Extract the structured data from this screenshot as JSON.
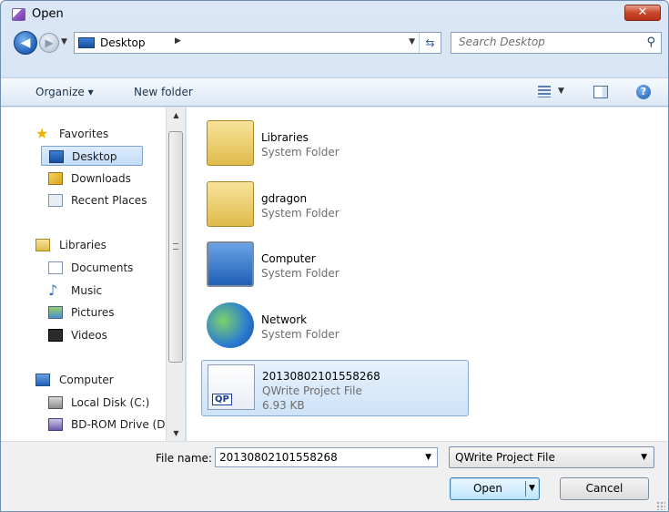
{
  "window": {
    "title": "Open"
  },
  "nav": {
    "back_glyph": "◀",
    "forward_glyph": "▶",
    "address": "Desktop",
    "search_placeholder": "Search Desktop"
  },
  "toolbar": {
    "organize": "Organize ▾",
    "new_folder": "New folder",
    "help": "?"
  },
  "sidebar": {
    "items": [
      {
        "label": "Favorites",
        "icon": "star-icon"
      },
      {
        "label": "Desktop",
        "icon": "desktop-icon",
        "selected": true
      },
      {
        "label": "Downloads",
        "icon": "downloads-icon"
      },
      {
        "label": "Recent Places",
        "icon": "recent-places-icon"
      },
      {
        "label": "Libraries",
        "icon": "libraries-icon"
      },
      {
        "label": "Documents",
        "icon": "documents-icon"
      },
      {
        "label": "Music",
        "icon": "music-icon"
      },
      {
        "label": "Pictures",
        "icon": "pictures-icon"
      },
      {
        "label": "Videos",
        "icon": "videos-icon"
      },
      {
        "label": "Computer",
        "icon": "computer-icon"
      },
      {
        "label": "Local Disk (C:)",
        "icon": "local-disk-icon"
      },
      {
        "label": "BD-ROM Drive (D",
        "icon": "bd-rom-icon"
      }
    ]
  },
  "files": [
    {
      "name": "Libraries",
      "type": "System Folder",
      "icon": "libraries-folder-icon"
    },
    {
      "name": "gdragon",
      "type": "System Folder",
      "icon": "user-folder-icon"
    },
    {
      "name": "Computer",
      "type": "System Folder",
      "icon": "computer-icon"
    },
    {
      "name": "Network",
      "type": "System Folder",
      "icon": "network-icon"
    },
    {
      "name": "20130802101558268",
      "type": "QWrite Project File",
      "size": "6.93 KB",
      "icon": "qwrite-file-icon",
      "badge": "QP",
      "selected": true
    }
  ],
  "footer": {
    "file_name_label": "File name:",
    "file_name_value": "20130802101558268",
    "file_type": "QWrite Project File",
    "open_label": "Open",
    "cancel_label": "Cancel"
  },
  "colors": {
    "accent": "#3c7fb1",
    "selection": "#cfe3f8",
    "close": "#c9472a"
  }
}
